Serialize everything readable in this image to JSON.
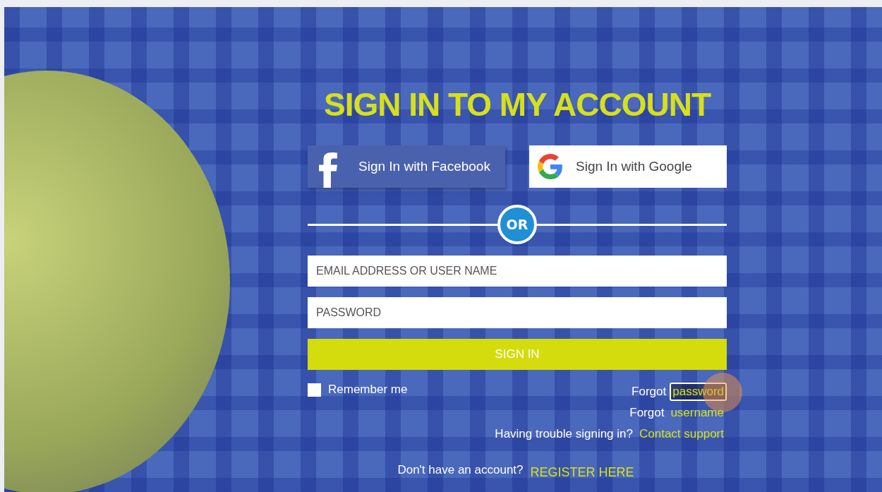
{
  "title": "SIGN IN TO MY ACCOUNT",
  "social_buttons": [
    {
      "kind": "facebook",
      "label": "Sign In with Facebook"
    },
    {
      "kind": "google",
      "label": "Sign In with Google"
    }
  ],
  "divider": {
    "label": "OR"
  },
  "fields": [
    {
      "placeholder": "EMAIL ADDRESS OR USER NAME"
    },
    {
      "placeholder": "PASSWORD"
    }
  ],
  "submit": {
    "label": "SIGN IN"
  },
  "remember": {
    "label": "Remember me",
    "checked": false
  },
  "help_links": [
    {
      "prefix": "Forgot",
      "link": "password",
      "focused": true
    },
    {
      "prefix": "Forgot",
      "link": "username",
      "focused": false
    },
    {
      "prefix": "Having trouble signing in?",
      "link": "Contact support",
      "focused": false
    }
  ],
  "register": {
    "prefix": "Don't have an account?",
    "link": "REGISTER HERE"
  }
}
